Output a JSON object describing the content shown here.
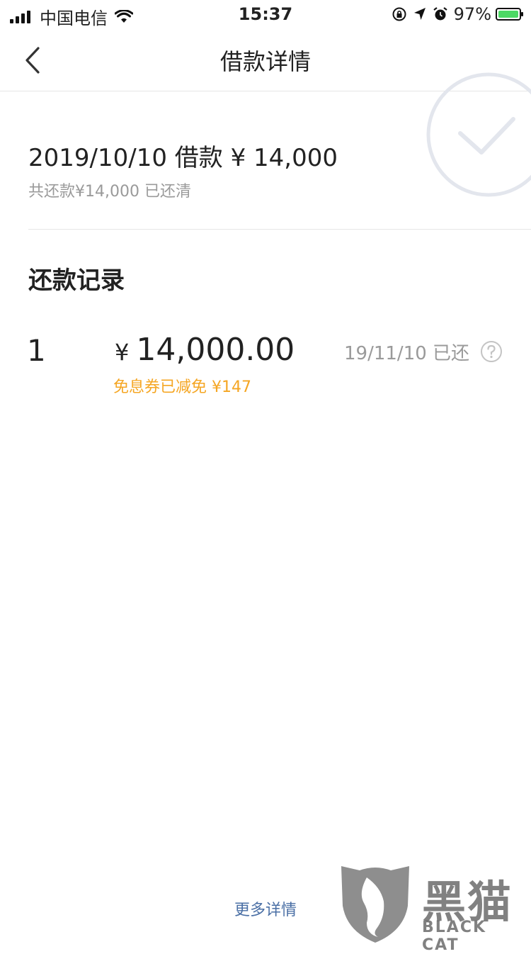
{
  "status_bar": {
    "carrier": "中国电信",
    "time": "15:37",
    "battery": "97%",
    "icons": [
      "signal-icon",
      "wifi-icon",
      "rotation-lock-icon",
      "location-icon",
      "alarm-icon",
      "battery-icon"
    ]
  },
  "nav": {
    "title": "借款详情",
    "back_icon": "chevron-left-icon"
  },
  "summary": {
    "title": "2019/10/10 借款 ¥ 14,000",
    "subtitle": "共还款¥14,000 已还清",
    "badge_icon": "check-circle-icon"
  },
  "records": {
    "section_title": "还款记录",
    "items": [
      {
        "index": "1",
        "currency": "¥",
        "amount": "14,000.00",
        "date_status": "19/11/10 已还",
        "discount": "免息券已减免 ¥147",
        "help_icon": "question-circle-icon"
      }
    ]
  },
  "footer": {
    "more_link": "更多详情"
  },
  "watermark": {
    "cn": "黑猫",
    "en": "BLACK CAT"
  },
  "colors": {
    "discount": "#f5a623",
    "link": "#4a6fa5",
    "muted": "#9a9a9a",
    "divider": "#e6e6e6"
  }
}
